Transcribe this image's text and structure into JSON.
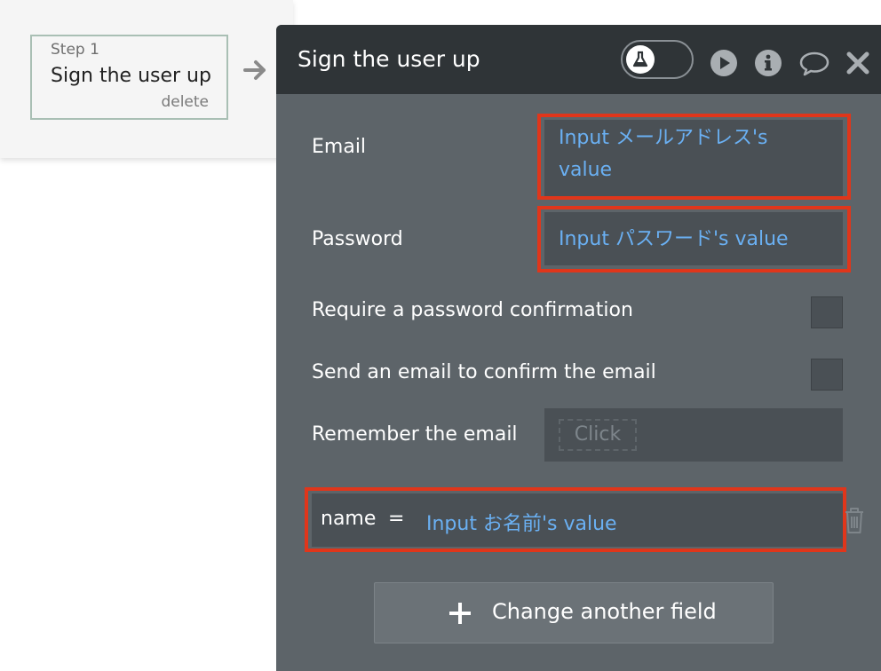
{
  "step": {
    "number_label": "Step 1",
    "title": "Sign the user up",
    "delete_label": "delete"
  },
  "panel": {
    "title": "Sign the user up",
    "icons": [
      "flask-icon",
      "play-icon",
      "info-icon",
      "comment-icon",
      "close-icon"
    ]
  },
  "fields": {
    "email_label": "Email",
    "email_value_line1": "Input メールアドレス's",
    "email_value_line2": "value",
    "password_label": "Password",
    "password_value": "Input パスワード's value",
    "require_confirm_label": "Require a password confirmation",
    "send_email_label": "Send an email to confirm the email",
    "remember_label": "Remember the email",
    "remember_button": "Click",
    "name_key": "name",
    "name_eq": "=",
    "name_value": "Input お名前's value"
  },
  "change_field_button": "Change another field",
  "colors": {
    "panel_bg": "#5d6469",
    "header_bg": "#2f3437",
    "field_bg": "#4a5055",
    "dynamic_text": "#6ab0f3",
    "highlight": "#e0361b"
  }
}
